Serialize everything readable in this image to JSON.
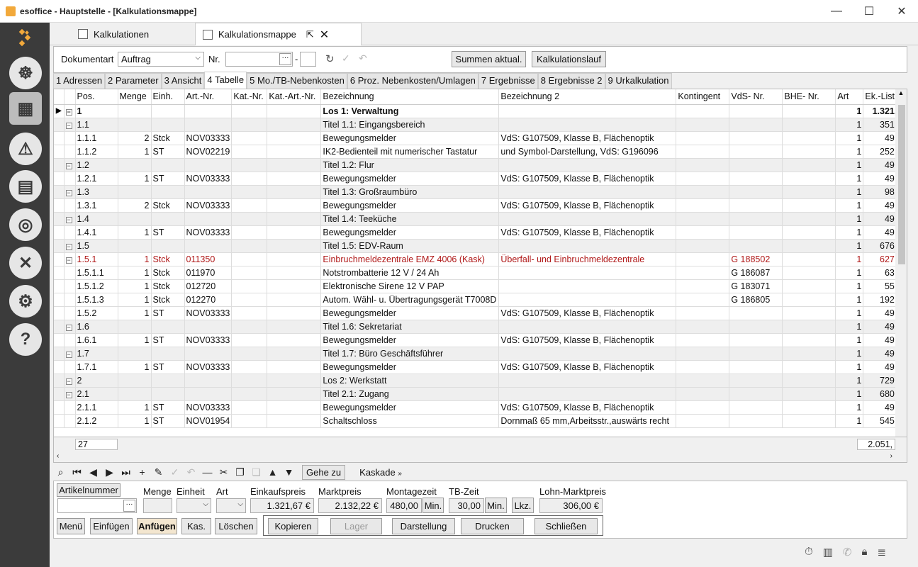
{
  "window": {
    "title": "esoffice - Hauptstelle - [Kalkulationsmappe]"
  },
  "doc_tabs": [
    {
      "label": "Kalkulationen"
    },
    {
      "label": "Kalkulationsmappe"
    }
  ],
  "toolbar": {
    "doc_type_label": "Dokumentart",
    "doc_type_value": "Auftrag",
    "nr_label": "Nr.",
    "nr_sep": "-",
    "sum_btn": "Summen aktual.",
    "calc_btn": "Kalkulationslauf"
  },
  "panel_tabs": [
    "1 Adressen",
    "2 Parameter",
    "3 Ansicht",
    "4 Tabelle",
    "5 Mo./TB-Nebenkosten",
    "6 Proz. Nebenkosten/Umlagen",
    "7 Ergebnisse",
    "8 Ergebnisse 2",
    "9 Urkalkulation"
  ],
  "grid": {
    "columns": [
      "Pos.",
      "Menge",
      "Einh.",
      "Art.-Nr.",
      "Kat.-Nr.",
      "Kat.-Art.-Nr.",
      "Bezeichnung",
      "Bezeichnung 2",
      "Kontingent",
      "VdS- Nr.",
      "BHE- Nr.",
      "Art",
      "Ek.-List"
    ],
    "rows": [
      {
        "pos": "1",
        "menge": "",
        "einh": "",
        "art": "",
        "bez": "Los 1: Verwaltung",
        "bez2": "",
        "vds": "",
        "a": "1",
        "ek": "1.321,",
        "type": "bold"
      },
      {
        "pos": "1.1",
        "menge": "",
        "einh": "",
        "art": "",
        "bez": "Titel 1.1: Eingangsbereich",
        "bez2": "",
        "vds": "",
        "a": "1",
        "ek": "351,",
        "type": "grp"
      },
      {
        "pos": "1.1.1",
        "menge": "2",
        "einh": "Stck",
        "art": "NOV03333",
        "bez": "Bewegungsmelder",
        "bez2": "VdS: G107509, Klasse B, Flächenoptik",
        "vds": "",
        "a": "1",
        "ek": "49,",
        "type": ""
      },
      {
        "pos": "1.1.2",
        "menge": "1",
        "einh": "ST",
        "art": "NOV02219",
        "bez": "IK2-Bedienteil mit numerischer Tastatur",
        "bez2": "und Symbol-Darstellung, VdS: G196096",
        "vds": "",
        "a": "1",
        "ek": "252,",
        "type": ""
      },
      {
        "pos": "1.2",
        "menge": "",
        "einh": "",
        "art": "",
        "bez": "Titel 1.2: Flur",
        "bez2": "",
        "vds": "",
        "a": "1",
        "ek": "49,",
        "type": "grp"
      },
      {
        "pos": "1.2.1",
        "menge": "1",
        "einh": "ST",
        "art": "NOV03333",
        "bez": "Bewegungsmelder",
        "bez2": "VdS: G107509, Klasse B, Flächenoptik",
        "vds": "",
        "a": "1",
        "ek": "49,",
        "type": ""
      },
      {
        "pos": "1.3",
        "menge": "",
        "einh": "",
        "art": "",
        "bez": "Titel 1.3: Großraumbüro",
        "bez2": "",
        "vds": "",
        "a": "1",
        "ek": "98,",
        "type": "grp"
      },
      {
        "pos": "1.3.1",
        "menge": "2",
        "einh": "Stck",
        "art": "NOV03333",
        "bez": "Bewegungsmelder",
        "bez2": "VdS: G107509, Klasse B, Flächenoptik",
        "vds": "",
        "a": "1",
        "ek": "49,",
        "type": ""
      },
      {
        "pos": "1.4",
        "menge": "",
        "einh": "",
        "art": "",
        "bez": "Titel 1.4: Teeküche",
        "bez2": "",
        "vds": "",
        "a": "1",
        "ek": "49,",
        "type": "grp"
      },
      {
        "pos": "1.4.1",
        "menge": "1",
        "einh": "ST",
        "art": "NOV03333",
        "bez": "Bewegungsmelder",
        "bez2": "VdS: G107509, Klasse B, Flächenoptik",
        "vds": "",
        "a": "1",
        "ek": "49,",
        "type": ""
      },
      {
        "pos": "1.5",
        "menge": "",
        "einh": "",
        "art": "",
        "bez": "Titel 1.5: EDV-Raum",
        "bez2": "",
        "vds": "",
        "a": "1",
        "ek": "676,",
        "type": "grp"
      },
      {
        "pos": "1.5.1",
        "menge": "1",
        "einh": "Stck",
        "art": "011350",
        "bez": "Einbruchmeldezentrale EMZ 4006 (Kask)",
        "bez2": "Überfall- und Einbruchmeldezentrale",
        "vds": "G 188502",
        "a": "1",
        "ek": "627,",
        "type": "red"
      },
      {
        "pos": "1.5.1.1",
        "menge": "1",
        "einh": "Stck",
        "art": "011970",
        "bez": "Notstrombatterie 12 V / 24 Ah",
        "bez2": "",
        "vds": "G 186087",
        "a": "1",
        "ek": "63,",
        "type": ""
      },
      {
        "pos": "1.5.1.2",
        "menge": "1",
        "einh": "Stck",
        "art": "012720",
        "bez": "Elektronische Sirene 12 V PAP",
        "bez2": "",
        "vds": "G 183071",
        "a": "1",
        "ek": "55,",
        "type": ""
      },
      {
        "pos": "1.5.1.3",
        "menge": "1",
        "einh": "Stck",
        "art": "012270",
        "bez": "Autom. Wähl- u. Übertragungsgerät T7008D",
        "bez2": "",
        "vds": "G 186805",
        "a": "1",
        "ek": "192,",
        "type": ""
      },
      {
        "pos": "1.5.2",
        "menge": "1",
        "einh": "ST",
        "art": "NOV03333",
        "bez": "Bewegungsmelder",
        "bez2": "VdS: G107509, Klasse B, Flächenoptik",
        "vds": "",
        "a": "1",
        "ek": "49,",
        "type": ""
      },
      {
        "pos": "1.6",
        "menge": "",
        "einh": "",
        "art": "",
        "bez": "Titel 1.6: Sekretariat",
        "bez2": "",
        "vds": "",
        "a": "1",
        "ek": "49,",
        "type": "grp"
      },
      {
        "pos": "1.6.1",
        "menge": "1",
        "einh": "ST",
        "art": "NOV03333",
        "bez": "Bewegungsmelder",
        "bez2": "VdS: G107509, Klasse B, Flächenoptik",
        "vds": "",
        "a": "1",
        "ek": "49,",
        "type": ""
      },
      {
        "pos": "1.7",
        "menge": "",
        "einh": "",
        "art": "",
        "bez": "Titel 1.7: Büro Geschäftsführer",
        "bez2": "",
        "vds": "",
        "a": "1",
        "ek": "49,",
        "type": "grp"
      },
      {
        "pos": "1.7.1",
        "menge": "1",
        "einh": "ST",
        "art": "NOV03333",
        "bez": "Bewegungsmelder",
        "bez2": "VdS: G107509, Klasse B, Flächenoptik",
        "vds": "",
        "a": "1",
        "ek": "49,",
        "type": ""
      },
      {
        "pos": "2",
        "menge": "",
        "einh": "",
        "art": "",
        "bez": "Los 2: Werkstatt",
        "bez2": "",
        "vds": "",
        "a": "1",
        "ek": "729,",
        "type": "grp"
      },
      {
        "pos": "2.1",
        "menge": "",
        "einh": "",
        "art": "",
        "bez": "Titel 2.1: Zugang",
        "bez2": "",
        "vds": "",
        "a": "1",
        "ek": "680,",
        "type": "grp"
      },
      {
        "pos": "2.1.1",
        "menge": "1",
        "einh": "ST",
        "art": "NOV03333",
        "bez": "Bewegungsmelder",
        "bez2": "VdS: G107509, Klasse B, Flächenoptik",
        "vds": "",
        "a": "1",
        "ek": "49,",
        "type": ""
      },
      {
        "pos": "2.1.2",
        "menge": "1",
        "einh": "ST",
        "art": "NOV01954",
        "bez": "Schaltschloss",
        "bez2": "Dornmaß 65 mm,Arbeitsstr.,auswärts recht",
        "vds": "",
        "a": "1",
        "ek": "545,",
        "type": ""
      }
    ],
    "footer_count": "27",
    "footer_sum": "2.051,"
  },
  "navbar": {
    "gehe_zu": "Gehe zu",
    "kaskade": "Kaskade"
  },
  "detail": {
    "artikelnummer_btn": "Artikelnummer",
    "menge_label": "Menge",
    "einheit_label": "Einheit",
    "art_label": "Art",
    "einkaufspreis_label": "Einkaufspreis",
    "einkaufspreis": "1.321,67 €",
    "marktpreis_label": "Marktpreis",
    "marktpreis": "2.132,22 €",
    "montagezeit_label": "Montagezeit",
    "montagezeit": "480,00",
    "min1": "Min.",
    "tbzeit_label": "TB-Zeit",
    "tbzeit": "30,00",
    "min2": "Min.",
    "lkz": "Lkz.",
    "lohn_label": "Lohn-Marktpreis",
    "lohn": "306,00 €"
  },
  "actions": [
    "Menü",
    "Einfügen",
    "Anfügen",
    "Kas.",
    "Löschen",
    "Kopieren",
    "Lager",
    "Darstellung",
    "Drucken",
    "Schließen"
  ]
}
